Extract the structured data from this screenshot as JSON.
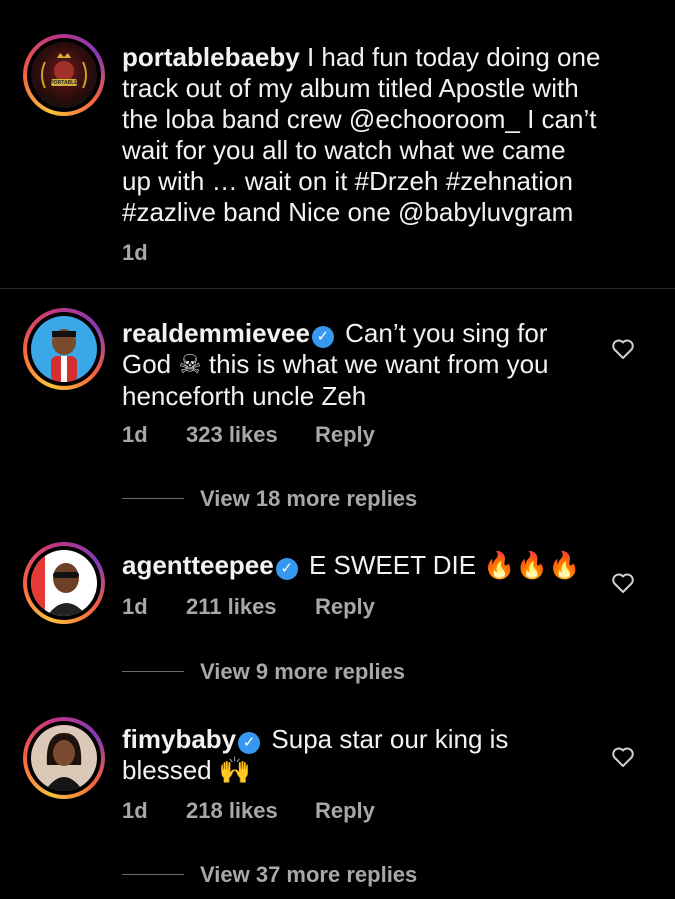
{
  "caption": {
    "username": "portablebaeby",
    "lines": [
      " I had fun today doing one",
      "track out of my album titled Apostle with",
      "the loba band crew  @echooroom_  I can’t",
      "wait for you all to watch what we came",
      "up with … wait on it #Drzeh #zehnation",
      "#zazlive band  Nice one @babyluvgram"
    ],
    "time": "1d",
    "avatar_text": "PORTABLE"
  },
  "comments": [
    {
      "username": "realdemmievee",
      "verified": true,
      "line1": "Can’t you sing for",
      "line2a": "God",
      "line2_emoji": "☠",
      "line2b": " this is what we want from you",
      "line3": "henceforth uncle Zeh",
      "time": "1d",
      "likes": "323 likes",
      "reply": "Reply",
      "view_replies": "View 18 more replies"
    },
    {
      "username": "agentteepee",
      "verified": true,
      "text": "E SWEET DIE ",
      "emoji": "🔥🔥🔥",
      "time": "1d",
      "likes": "211 likes",
      "reply": "Reply",
      "view_replies": "View 9 more replies"
    },
    {
      "username": "fimybaby",
      "verified": true,
      "line1": "Supa star our king is",
      "line2": "blessed ",
      "emoji": "🙌",
      "time": "1d",
      "likes": "218 likes",
      "reply": "Reply",
      "view_replies": "View 37 more replies"
    }
  ],
  "icons": {
    "verified": "verified-badge-icon",
    "heart": "heart-outline-icon"
  },
  "colors": {
    "background": "#000000",
    "text": "#f2f2f2",
    "muted": "#a8a8a8",
    "verified": "#3897f0"
  }
}
